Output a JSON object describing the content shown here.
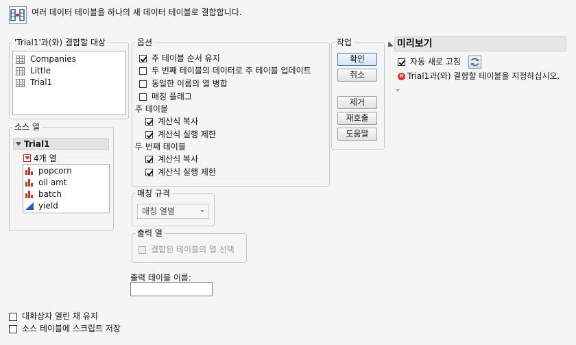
{
  "header": {
    "description": "여러 데이터 테이블을 하나의 새 데이터 테이블로 결합합니다."
  },
  "join_target": {
    "title": "'Trial1'과(와) 결합할 대상",
    "tables": [
      "Companies",
      "Little",
      "Trial1"
    ]
  },
  "source_columns": {
    "title": "소스 열",
    "table_name": "Trial1",
    "count_label": "4개 열",
    "columns": [
      {
        "name": "popcorn",
        "type": "nominal"
      },
      {
        "name": "oil amt",
        "type": "nominal"
      },
      {
        "name": "batch",
        "type": "nominal"
      },
      {
        "name": "yield",
        "type": "continuous"
      }
    ]
  },
  "options": {
    "title": "옵션",
    "items": [
      {
        "label": "주 테이블 순서 유지",
        "checked": true
      },
      {
        "label": "두 번째 테이블의 데이터로 주 테이블 업데이트",
        "checked": false
      },
      {
        "label": "동일한 이름의 열 병합",
        "checked": false
      },
      {
        "label": "매칭 플래그",
        "checked": false
      }
    ],
    "main_table_label": "주 테이블",
    "main_table_items": [
      {
        "label": "계산식 복사",
        "checked": true
      },
      {
        "label": "계산식 실행 제한",
        "checked": true
      }
    ],
    "second_table_label": "두 번째 테이블",
    "second_table_items": [
      {
        "label": "계산식 복사",
        "checked": true
      },
      {
        "label": "계산식 실행 제한",
        "checked": true
      }
    ]
  },
  "matching": {
    "title": "매칭 규격",
    "selected": "매칭 열별"
  },
  "output_columns": {
    "title": "출력 열",
    "checkbox_label": "결합된 테이블의 열 선택",
    "checked": false
  },
  "output_table": {
    "label": "출력 테이블 이름:",
    "value": ""
  },
  "actions": {
    "title": "작업",
    "ok": "확인",
    "cancel": "취소",
    "remove": "제거",
    "recall": "재호출",
    "help": "도움말"
  },
  "preview": {
    "title": "미리보기",
    "auto_refresh_label": "자동 새로 고침",
    "auto_refresh_checked": true,
    "error_message": "Trial1과(와) 결합할 테이블을 지정하십시오."
  },
  "footer": {
    "keep_open_label": "대화상자 열린 채 유지",
    "keep_open_checked": false,
    "save_script_label": "소스 테이블에 스크립트 저장",
    "save_script_checked": false
  },
  "colors": {
    "nominal": "#c0392b",
    "continuous": "#2a56c6",
    "error": "#d9362e",
    "accent": "#3c7fb1"
  }
}
